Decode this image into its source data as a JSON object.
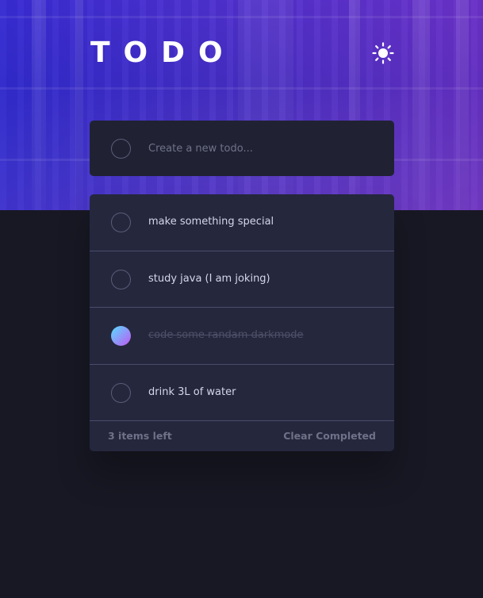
{
  "header": {
    "title": "TODO",
    "theme_icon": "sun-icon"
  },
  "new_todo": {
    "placeholder": "Create a new todo..."
  },
  "todos": [
    {
      "label": "make something special",
      "completed": false
    },
    {
      "label": "study java (I am joking)",
      "completed": false
    },
    {
      "label": "code some randam darkmode",
      "completed": true
    },
    {
      "label": "drink 3L of water",
      "completed": false
    }
  ],
  "footer": {
    "items_left": "3 items left",
    "clear_label": "Clear Completed"
  },
  "colors": {
    "background": "#181824",
    "card": "#25273d",
    "check_gradient_start": "#57ddff",
    "check_gradient_end": "#c058f3"
  }
}
